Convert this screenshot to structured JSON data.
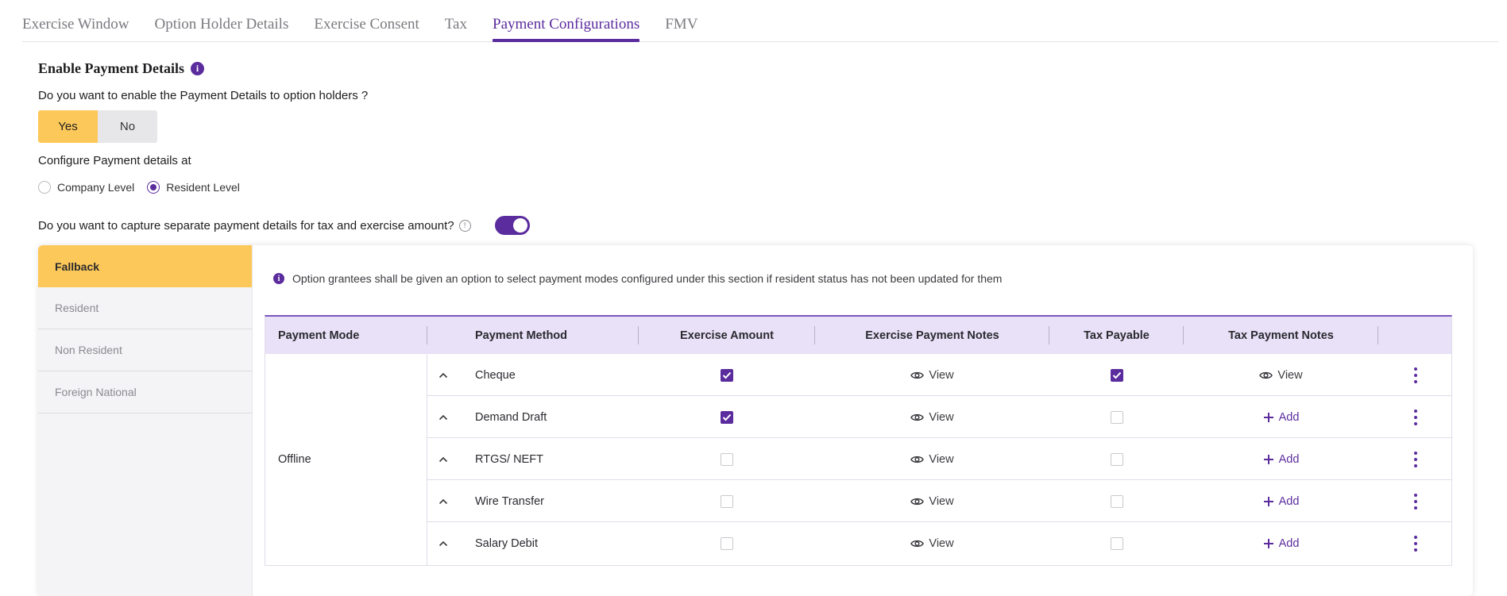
{
  "tabs": [
    {
      "label": "Exercise Window"
    },
    {
      "label": "Option Holder Details"
    },
    {
      "label": "Exercise Consent"
    },
    {
      "label": "Tax"
    },
    {
      "label": "Payment Configurations"
    },
    {
      "label": "FMV"
    }
  ],
  "active_tab_index": 4,
  "section_title": "Enable Payment Details",
  "enable_question": "Do you want to enable the Payment Details to option holders ?",
  "yes_label": "Yes",
  "no_label": "No",
  "enable_selected": "Yes",
  "configure_label": "Configure Payment details at",
  "level_options": [
    {
      "label": "Company Level",
      "selected": false
    },
    {
      "label": "Resident Level",
      "selected": true
    }
  ],
  "separate_question": "Do you want to capture separate payment details for tax and exercise amount?",
  "separate_toggle_on": true,
  "sidebar": [
    {
      "label": "Fallback",
      "active": true
    },
    {
      "label": "Resident",
      "active": false
    },
    {
      "label": "Non Resident",
      "active": false
    },
    {
      "label": "Foreign National",
      "active": false
    }
  ],
  "info_note": "Option grantees shall be given an option to select payment modes configured under this section if resident status has not been updated for them",
  "table": {
    "headers": {
      "mode": "Payment Mode",
      "method": "Payment Method",
      "exercise_amount": "Exercise Amount",
      "exercise_notes": "Exercise Payment Notes",
      "tax_payable": "Tax Payable",
      "tax_notes": "Tax Payment Notes"
    },
    "mode_value": "Offline",
    "rows": [
      {
        "method": "Cheque",
        "exercise_amount": true,
        "exercise_notes": "View",
        "tax_payable": true,
        "tax_notes": "View"
      },
      {
        "method": "Demand Draft",
        "exercise_amount": true,
        "exercise_notes": "View",
        "tax_payable": false,
        "tax_notes": "Add"
      },
      {
        "method": "RTGS/ NEFT",
        "exercise_amount": false,
        "exercise_notes": "View",
        "tax_payable": false,
        "tax_notes": "Add"
      },
      {
        "method": "Wire Transfer",
        "exercise_amount": false,
        "exercise_notes": "View",
        "tax_payable": false,
        "tax_notes": "Add"
      },
      {
        "method": "Salary Debit",
        "exercise_amount": false,
        "exercise_notes": "View",
        "tax_payable": false,
        "tax_notes": "Add"
      }
    ]
  },
  "colors": {
    "accent": "#5b2c9e",
    "highlight": "#fdc85a",
    "header_bg": "#e9e1f7"
  },
  "icons": {
    "info": "info-icon",
    "hint": "help-circle-icon",
    "view": "eye-icon",
    "add": "plus-icon",
    "row_toggle": "chevron-up-icon",
    "menu": "kebab-menu-icon"
  }
}
